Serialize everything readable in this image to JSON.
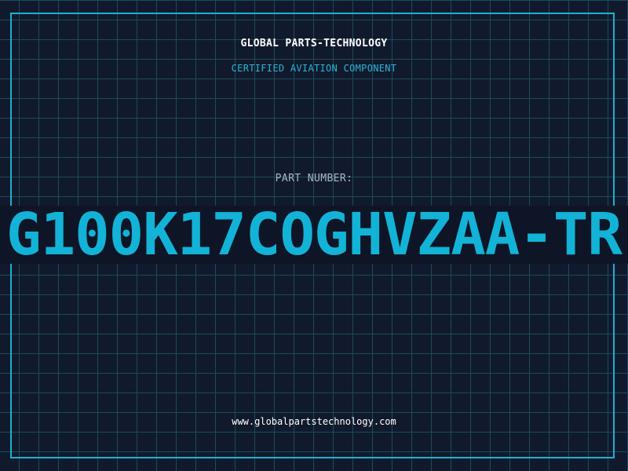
{
  "header": {
    "company": "GLOBAL PARTS-TECHNOLOGY",
    "subtitle": "CERTIFIED AVIATION COMPONENT"
  },
  "part": {
    "label": "PART NUMBER:",
    "number": "G100K17COGHVZAA-TR"
  },
  "footer": {
    "url": "www.globalpartstechnology.com"
  },
  "colors": {
    "background": "#111a2c",
    "grid": "#1c4a5e",
    "accent": "#12b3d6",
    "band": "#0d1527"
  }
}
